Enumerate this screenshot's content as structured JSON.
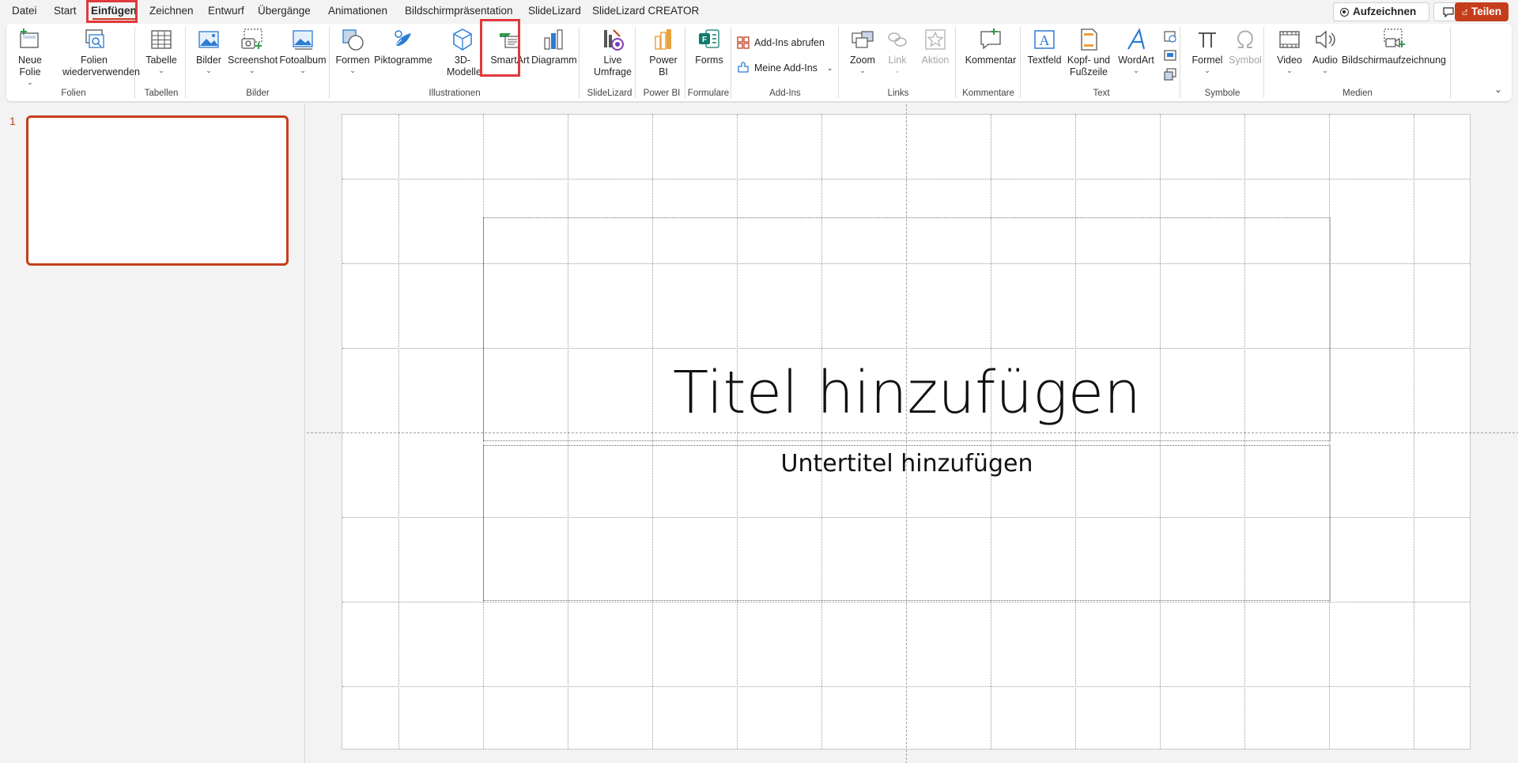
{
  "menu": {
    "tabs": [
      "Datei",
      "Start",
      "Einfügen",
      "Zeichnen",
      "Entwurf",
      "Übergänge",
      "Animationen",
      "Bildschirmpräsentation",
      "SlideLizard",
      "SlideLizard CREATOR"
    ],
    "active_tab": "Einfügen",
    "record_label": "Aufzeichnen",
    "share_label": "Teilen"
  },
  "ribbon": {
    "buttons": {
      "new_slide": "Neue Folie",
      "reuse_slides": "Folien wiederverwenden",
      "table": "Tabelle",
      "images": "Bilder",
      "screenshot": "Screenshot",
      "photo_album": "Fotoalbum",
      "shapes": "Formen",
      "icons": "Piktogramme",
      "models_3d": "3D-Modelle",
      "smartart": "SmartArt",
      "chart": "Diagramm",
      "live_poll": "Live Umfrage",
      "power_bi": "Power BI",
      "forms": "Forms",
      "get_addins": "Add-Ins abrufen",
      "my_addins": "Meine Add-Ins",
      "zoom": "Zoom",
      "link": "Link",
      "action": "Aktion",
      "comment": "Kommentar",
      "textbox": "Textfeld",
      "header_footer": "Kopf- und Fußzeile",
      "wordart": "WordArt",
      "equation": "Formel",
      "symbol": "Symbol",
      "video": "Video",
      "audio": "Audio",
      "screen_recording": "Bildschirmaufzeichnung"
    },
    "groups": {
      "slides": "Folien",
      "tables": "Tabellen",
      "images": "Bilder",
      "illustrations": "Illustrationen",
      "slidelizard": "SlideLizard",
      "power_bi": "Power BI",
      "forms": "Formulare",
      "addins": "Add-Ins",
      "links": "Links",
      "comments": "Kommentare",
      "text": "Text",
      "symbols": "Symbole",
      "media": "Medien"
    },
    "highlighted": [
      "Einfügen",
      "SmartArt"
    ]
  },
  "slides_pane": {
    "slide_number": "1"
  },
  "slide": {
    "title_placeholder": "Titel hinzufügen",
    "subtitle_placeholder": "Untertitel hinzufügen"
  },
  "colors": {
    "accent": "#c43e1c",
    "highlight": "#e0393e",
    "blue_icon": "#2b7cd3",
    "green_icon": "#2e9b4c"
  }
}
